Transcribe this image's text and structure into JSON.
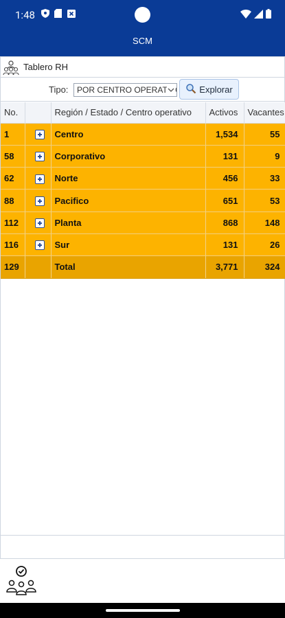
{
  "status_bar": {
    "time": "1:48"
  },
  "app_bar": {
    "title": "SCM"
  },
  "breadcrumb": {
    "title": "Tablero RH",
    "icon": "people-group-icon"
  },
  "filter": {
    "label": "Tipo:",
    "selected": "POR CENTRO OPERATIVO",
    "button_label": "Explorar",
    "button_icon": "search-icon"
  },
  "table": {
    "headers": {
      "no": "No.",
      "expand": "",
      "region": "Región / Estado / Centro operativo",
      "activos": "Activos",
      "vacantes": "Vacantes"
    },
    "rows": [
      {
        "no": "1",
        "region": "Centro",
        "activos": "1,534",
        "vacantes": "55"
      },
      {
        "no": "58",
        "region": "Corporativo",
        "activos": "131",
        "vacantes": "9"
      },
      {
        "no": "62",
        "region": "Norte",
        "activos": "456",
        "vacantes": "33"
      },
      {
        "no": "88",
        "region": "Pacifico",
        "activos": "651",
        "vacantes": "53"
      },
      {
        "no": "112",
        "region": "Planta",
        "activos": "868",
        "vacantes": "148"
      },
      {
        "no": "116",
        "region": "Sur",
        "activos": "131",
        "vacantes": "26"
      }
    ],
    "total": {
      "no": "129",
      "region": "Total",
      "activos": "3,771",
      "vacantes": "324"
    }
  },
  "colors": {
    "header_blue": "#0a3b96",
    "row_orange": "#fdb300",
    "total_orange": "#e9a400"
  }
}
